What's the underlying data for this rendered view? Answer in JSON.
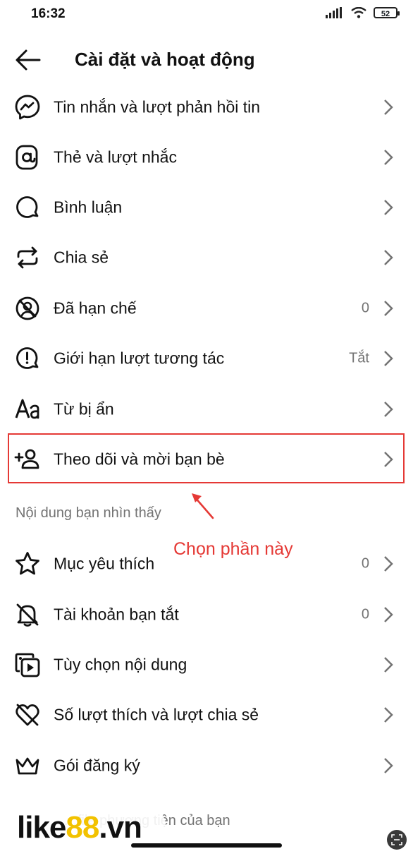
{
  "status": {
    "time": "16:32",
    "battery": "52"
  },
  "header": {
    "title": "Cài đặt và hoạt động"
  },
  "rows_top": [
    {
      "icon": "messenger-icon",
      "label": "Tin nhắn và lượt phản hồi tin",
      "value": ""
    },
    {
      "icon": "at-sign-icon",
      "label": "Thẻ và lượt nhắc",
      "value": ""
    },
    {
      "icon": "comment-icon",
      "label": "Bình luận",
      "value": ""
    },
    {
      "icon": "share-icon",
      "label": "Chia sẻ",
      "value": ""
    },
    {
      "icon": "restricted-icon",
      "label": "Đã hạn chế",
      "value": "0"
    },
    {
      "icon": "limit-interactions-icon",
      "label": "Giới hạn lượt tương tác",
      "value": "Tắt"
    },
    {
      "icon": "hidden-words-icon",
      "label": "Từ bị ẩn",
      "value": ""
    },
    {
      "icon": "follow-invite-icon",
      "label": "Theo dõi và mời bạn bè",
      "value": ""
    }
  ],
  "section": {
    "title": "Nội dung bạn nhìn thấy"
  },
  "rows_bottom": [
    {
      "icon": "star-icon",
      "label": "Mục yêu thích",
      "value": "0"
    },
    {
      "icon": "muted-bell-icon",
      "label": "Tài khoản bạn tắt",
      "value": "0"
    },
    {
      "icon": "content-preferences-icon",
      "label": "Tùy chọn nội dung",
      "value": ""
    },
    {
      "icon": "heart-slash-icon",
      "label": "Số lượt thích và lượt chia sẻ",
      "value": ""
    },
    {
      "icon": "crown-icon",
      "label": "Gói đăng ký",
      "value": ""
    }
  ],
  "annotation": {
    "text": "Chọn phần này",
    "color": "#e53935"
  },
  "bottom_partial": "…file phương tiện của bạn",
  "watermark": {
    "part1": "like",
    "part2": "88",
    "part3": ".vn"
  },
  "colors": {
    "accent": "#e53935",
    "muted": "#737373",
    "watermark_yellow": "#f2c200"
  }
}
